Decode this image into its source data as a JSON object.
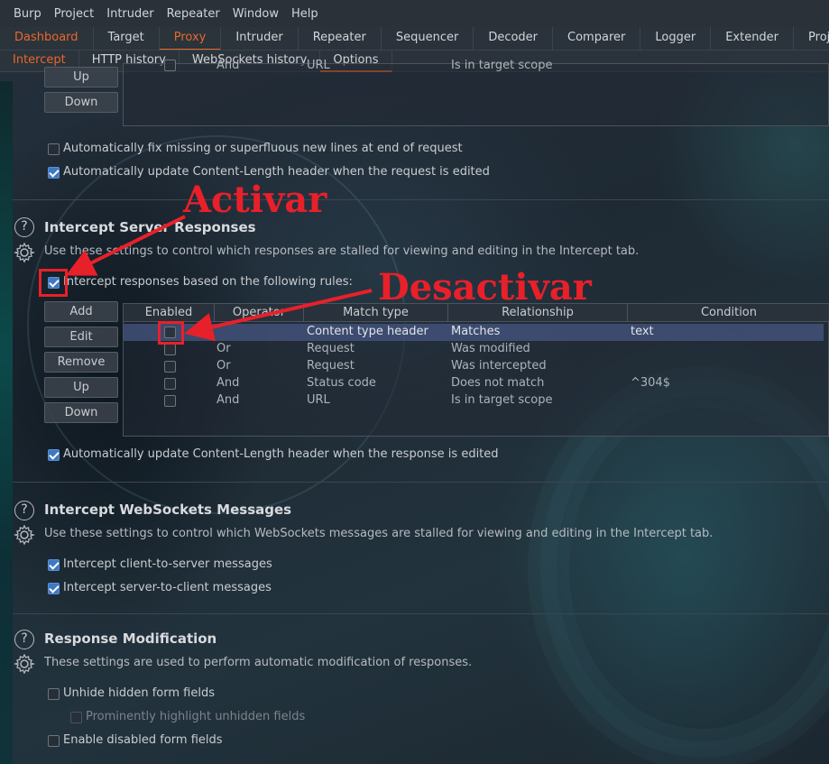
{
  "menu": [
    "Burp",
    "Project",
    "Intruder",
    "Repeater",
    "Window",
    "Help"
  ],
  "tabs": [
    {
      "label": "Dashboard",
      "state": "orange"
    },
    {
      "label": "Target",
      "state": ""
    },
    {
      "label": "Proxy",
      "state": "orange selected"
    },
    {
      "label": "Intruder",
      "state": ""
    },
    {
      "label": "Repeater",
      "state": ""
    },
    {
      "label": "Sequencer",
      "state": ""
    },
    {
      "label": "Decoder",
      "state": ""
    },
    {
      "label": "Comparer",
      "state": ""
    },
    {
      "label": "Logger",
      "state": ""
    },
    {
      "label": "Extender",
      "state": ""
    },
    {
      "label": "Proje",
      "state": ""
    }
  ],
  "subtabs": [
    {
      "label": "Intercept",
      "state": "orange"
    },
    {
      "label": "HTTP history",
      "state": ""
    },
    {
      "label": "WebSockets history",
      "state": ""
    },
    {
      "label": "Options",
      "state": "selected"
    }
  ],
  "top_section": {
    "partial_row": {
      "operator": "And",
      "match_type": "URL",
      "relationship": "Is in target scope"
    },
    "up_button": "Up",
    "down_button": "Down",
    "fix_newlines": {
      "label": "Automatically fix missing or superfluous new lines at end of request",
      "checked": false
    },
    "update_length_request": {
      "label": "Automatically update Content-Length header when the request is edited",
      "checked": true
    }
  },
  "server_responses": {
    "title": "Intercept Server Responses",
    "description": "Use these settings to control which responses are stalled for viewing and editing in the Intercept tab.",
    "intercept_rules": {
      "label": "Intercept responses based on the following rules:",
      "checked": true
    },
    "buttons": {
      "add": "Add",
      "edit": "Edit",
      "remove": "Remove",
      "up": "Up",
      "down": "Down"
    },
    "columns": [
      "Enabled",
      "Operator",
      "Match type",
      "Relationship",
      "Condition"
    ],
    "rows": [
      {
        "enabled": false,
        "operator": "",
        "match_type": "Content type header",
        "relationship": "Matches",
        "condition": "text",
        "selected": true
      },
      {
        "enabled": false,
        "operator": "Or",
        "match_type": "Request",
        "relationship": "Was modified",
        "condition": "",
        "selected": false
      },
      {
        "enabled": false,
        "operator": "Or",
        "match_type": "Request",
        "relationship": "Was intercepted",
        "condition": "",
        "selected": false
      },
      {
        "enabled": false,
        "operator": "And",
        "match_type": "Status code",
        "relationship": "Does not match",
        "condition": "^304$",
        "selected": false
      },
      {
        "enabled": false,
        "operator": "And",
        "match_type": "URL",
        "relationship": "Is in target scope",
        "condition": "",
        "selected": false
      }
    ],
    "update_length_response": {
      "label": "Automatically update Content-Length header when the response is edited",
      "checked": true
    }
  },
  "websockets": {
    "title": "Intercept WebSockets Messages",
    "description": "Use these settings to control which WebSockets messages are stalled for viewing and editing in the Intercept tab.",
    "client_to_server": {
      "label": "Intercept client-to-server messages",
      "checked": true
    },
    "server_to_client": {
      "label": "Intercept server-to-client messages",
      "checked": true
    }
  },
  "response_modification": {
    "title": "Response Modification",
    "description": "These settings are used to perform automatic modification of responses.",
    "unhide_fields": {
      "label": "Unhide hidden form fields",
      "checked": false
    },
    "highlight_unhidden": {
      "label": "Prominently highlight unhidden fields",
      "checked": false,
      "disabled": true
    },
    "enable_disabled": {
      "label": "Enable disabled form fields",
      "checked": false
    }
  },
  "annotations": {
    "activar": "Activar",
    "desactivar": "Desactivar",
    "color": "#e8202a"
  },
  "colors": {
    "accent": "#e8682c",
    "checkbox": "#3f78c2",
    "selected_row": "#465682"
  }
}
